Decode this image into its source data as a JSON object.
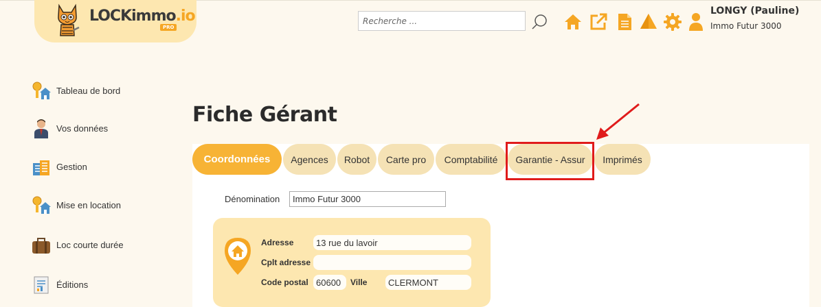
{
  "header": {
    "logo_text": "LOCKimmo",
    "logo_suffix": ".io",
    "logo_badge": "PRO",
    "search_placeholder": "Recherche ...",
    "toolbar_icons": [
      "home-icon",
      "external-link-icon",
      "document-icon",
      "alert-icon",
      "gear-icon"
    ],
    "user": {
      "name": "LONGY (Pauline)",
      "organization": "Immo Futur 3000"
    }
  },
  "sidebar": {
    "items": [
      {
        "label": "Tableau de bord",
        "icon": "keys-house-icon"
      },
      {
        "label": "Vos données",
        "icon": "person-icon"
      },
      {
        "label": "Gestion",
        "icon": "building-icon"
      },
      {
        "label": "Mise en location",
        "icon": "keys-house-icon"
      },
      {
        "label": "Loc courte durée",
        "icon": "suitcase-icon"
      },
      {
        "label": "Éditions",
        "icon": "report-icon"
      }
    ]
  },
  "page": {
    "title": "Fiche Gérant"
  },
  "tabs": [
    {
      "label": "Coordonnées",
      "active": true
    },
    {
      "label": "Agences",
      "active": false
    },
    {
      "label": "Robot",
      "active": false
    },
    {
      "label": "Carte pro",
      "active": false
    },
    {
      "label": "Comptabilité",
      "active": false
    },
    {
      "label": "Garantie - Assur",
      "active": false
    },
    {
      "label": "Imprimés",
      "active": false
    }
  ],
  "form": {
    "denomination_label": "Dénomination",
    "denomination_value": "Immo Futur 3000",
    "address": {
      "adresse_label": "Adresse",
      "adresse_value": "13 rue du lavoir",
      "cplt_label": "Cplt adresse",
      "cplt_value": "",
      "code_postal_label": "Code postal",
      "code_postal_value": "60600",
      "ville_label": "Ville",
      "ville_value": "CLERMONT"
    }
  },
  "colors": {
    "accent": "#f7b335",
    "tab_bg": "#f5e2b5",
    "highlight": "#e01b1b",
    "background": "#fdf8ee"
  }
}
